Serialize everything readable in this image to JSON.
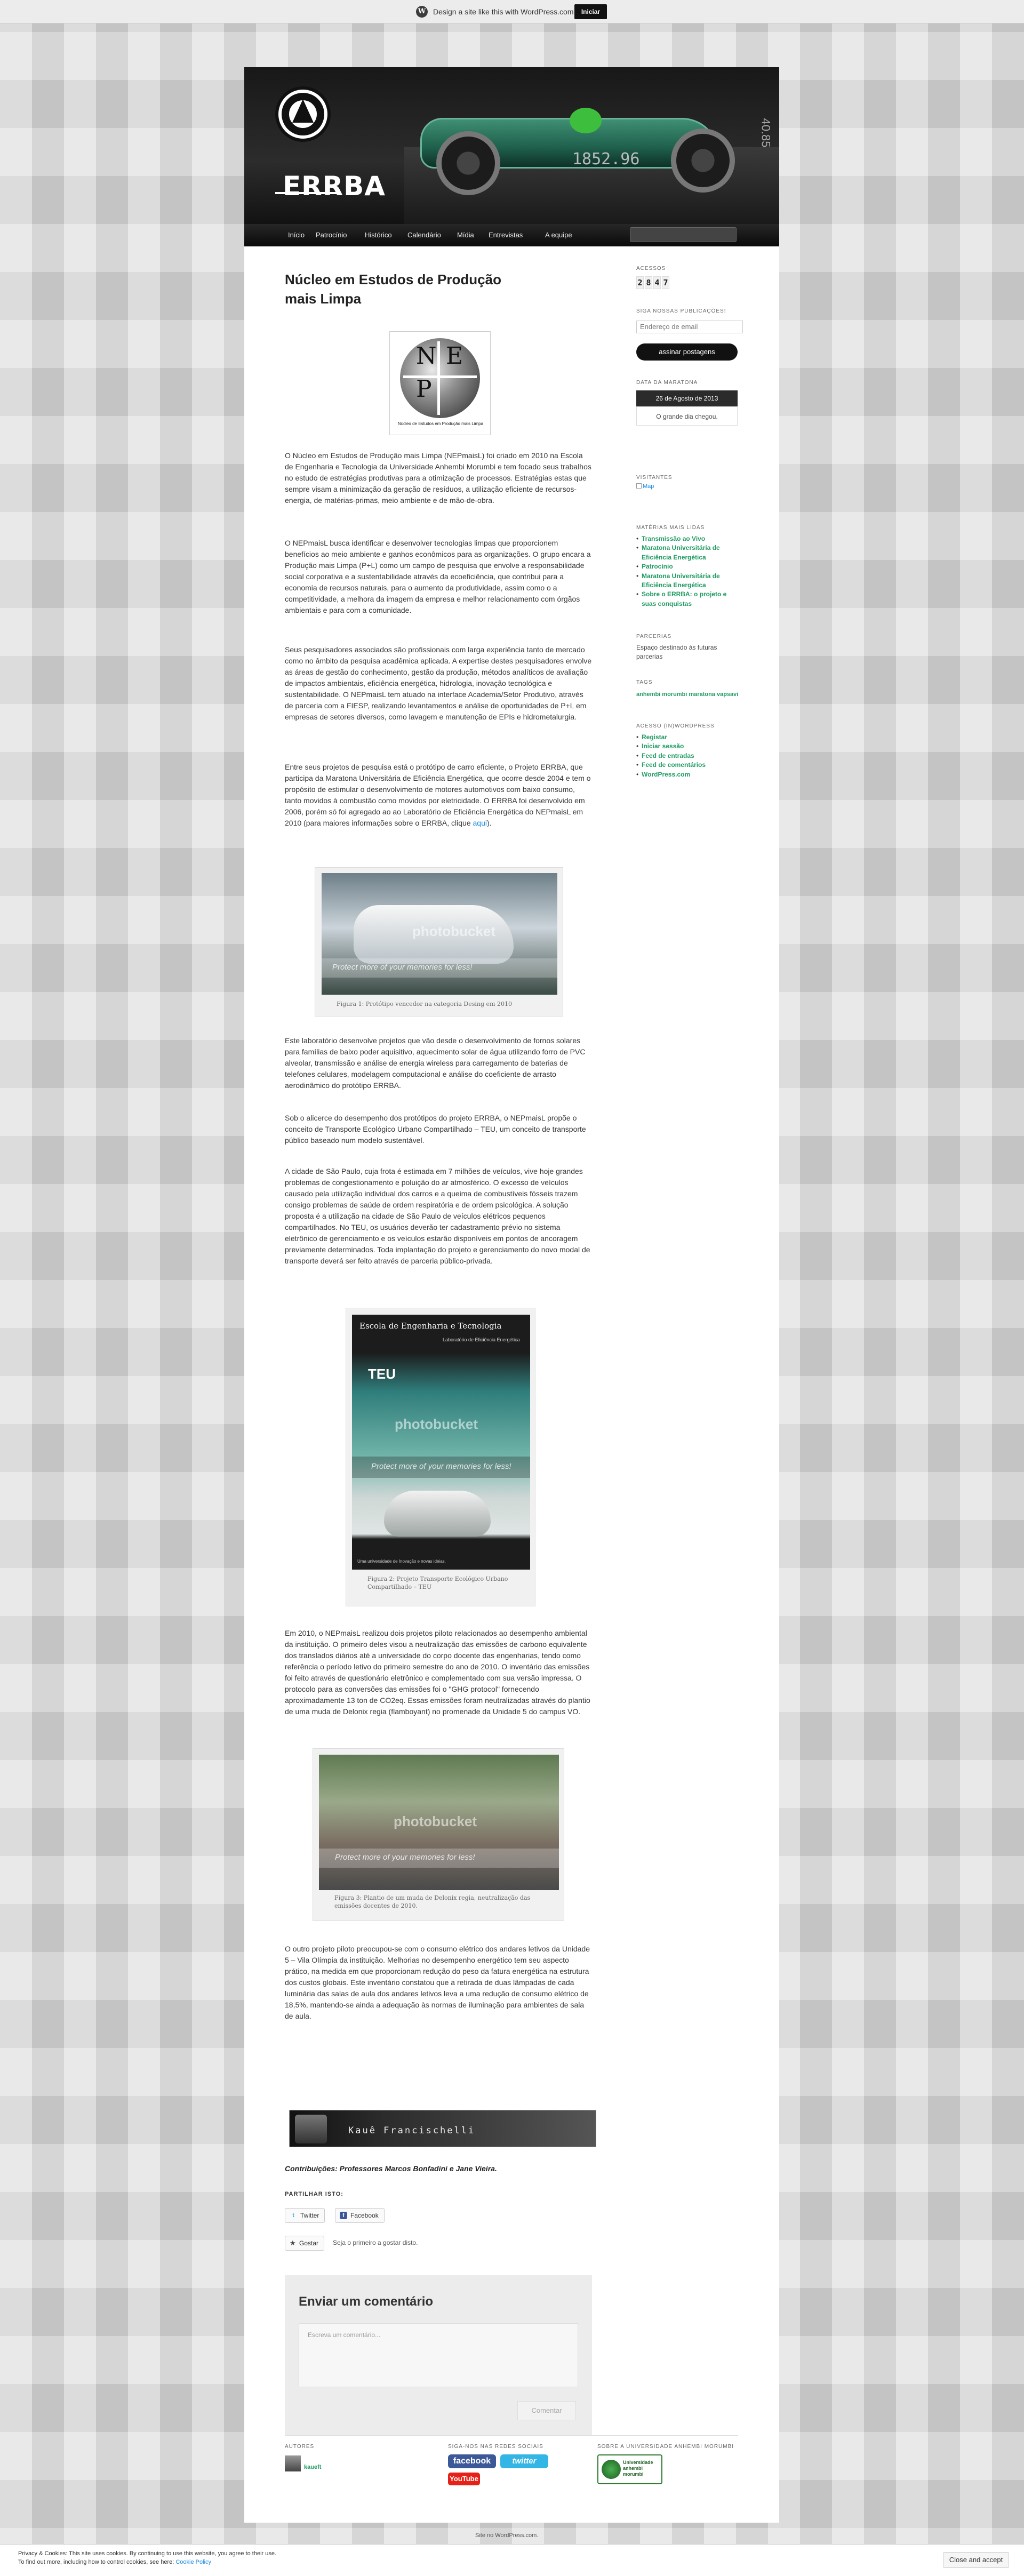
{
  "promo": {
    "text": "Design a site like this with WordPress.com",
    "button": "Iniciar"
  },
  "header": {
    "logo_text": "ERRBA",
    "banner_number": "1852.96",
    "banner_side_text": "40.85"
  },
  "nav": {
    "items": [
      "Início",
      "Patrocínio",
      "Histórico",
      "Calendário",
      "Mídia",
      "Entrevistas",
      "A equipe"
    ]
  },
  "post": {
    "title": "Núcleo em Estudos de Produção mais Limpa",
    "logo_caption": "Núcleo de Estudos em Produção mais Limpa",
    "paragraphs": [
      "O Núcleo em Estudos de Produção mais Limpa (NEPmaisL) foi criado em 2010 na Escola de Engenharia e Tecnologia da Universidade Anhembi Morumbi e tem focado seus trabalhos no estudo de estratégias produtivas para a otimização de processos. Estratégias estas que sempre visam a minimização da geração de resíduos, a utilização eficiente de recursos-energia, de matérias-primas, meio ambiente e de mão-de-obra.",
      "O NEPmaisL busca identificar e desenvolver tecnologias limpas que proporcionem benefícios ao meio ambiente e ganhos econômicos para as organizações. O grupo encara a Produção mais Limpa (P+L) como um campo de pesquisa que envolve a responsabilidade social corporativa e a sustentabilidade através da ecoeficiência, que contribui para a economia de recursos naturais, para o aumento da produtividade, assim como o a competitividade, a melhora da imagem da empresa e melhor relacionamento com órgãos ambientais e para com a comunidade.",
      "Seus pesquisadores associados são profissionais com larga experiência tanto de mercado como no âmbito da pesquisa acadêmica aplicada. A expertise destes pesquisadores envolve as áreas de gestão do conhecimento, gestão da produção, métodos analíticos de avaliação de impactos ambientais, eficiência energética, hidrologia, inovação tecnológica e sustentabilidade. O NEPmaisL tem atuado na interface Academia/Setor Produtivo, através de parceria com a FIESP, realizando levantamentos e análise de oportunidades de P+L em empresas de setores diversos, como lavagem e manutenção de EPIs e hidrometalurgia.",
      "Entre seus projetos de pesquisa está o protótipo de carro eficiente, o Projeto ERRBA, que participa da Maratona Universitária de Eficiência Energética, que ocorre desde 2004 e tem o propósito de estimular o desenvolvimento de motores automotivos com baixo consumo, tanto movidos à combustão como movidos por eletricidade. O ERRBA foi desenvolvido em 2006, porém só foi agregado ao ao Laboratório de Eficiência Energética do NEPmaisL em 2010 (para maiores informações sobre o ERRBA, clique",
      "Este laboratório desenvolve projetos que vão desde o desenvolvimento de fornos solares para famílias de baixo poder aquisitivo, aquecimento solar de água utilizando forro de PVC alveolar, transmissão e análise de energia wireless para carregamento de baterias de telefones celulares, modelagem computacional e análise do coeficiente de arrasto aerodinâmico do protótipo ERRBA.",
      "Sob o alicerce do desempenho dos protótipos do projeto ERRBA, o NEPmaisL propõe o conceito de Transporte Ecológico Urbano Compartilhado – TEU, um conceito de transporte público baseado num modelo sustentável.",
      "A cidade de São Paulo, cuja frota é estimada em 7 milhões de veículos, vive hoje grandes problemas de congestionamento e poluição do ar atmosférico. O excesso de veículos causado pela utilização individual dos carros e a queima de combustíveis fósseis trazem consigo problemas de saúde de ordem respiratória e de ordem psicológica. A solução proposta é a utilização na cidade de São Paulo de veículos elétricos pequenos compartilhados. No TEU, os usuários deverão ter cadastramento prévio no sistema eletrônico de gerenciamento e os veículos estarão disponíveis em pontos de ancoragem previamente determinados. Toda implantação do projeto e gerenciamento do novo modal de transporte deverá ser feito através de parceria público-privada.",
      "Em 2010, o NEPmaisL realizou dois projetos piloto relacionados ao desempenho ambiental da instituição. O primeiro deles visou a neutralização das emissões de carbono equivalente dos translados diários até a universidade do corpo docente das engenharias, tendo como referência o período letivo do primeiro semestre do ano de 2010. O inventário das emissões foi feito através de questionário eletrônico e complementado com sua versão impressa. O protocolo para as conversões das emissões foi o \"GHG protocol\" fornecendo aproximadamente 13 ton de CO2eq. Essas emissões foram neutralizadas através do plantio de uma muda de Delonix regia (flamboyant) no promenade da Unidade 5 do campus VO.",
      "O outro projeto piloto preocupou-se com o consumo elétrico dos andares letivos da Unidade 5 – Vila Olímpia da instituição. Melhorias no desempenho energético tem seu aspecto prático, na medida em que proporcionam redução do peso da fatura energética na estrutura dos custos globais. Este inventário constatou que a retirada de duas lâmpadas de cada luminária das salas de aula dos andares letivos leva a uma redução de consumo elétrico de 18,5%, mantendo-se ainda a adequação às normas de iluminação para ambientes de sala de aula."
    ],
    "link_aqui": "aqui",
    "link_close": ").",
    "figures": [
      {
        "caption": "Figura 1: Protótipo vencedor na categoria Desing em 2010",
        "watermark": "photobucket",
        "banner": "Protect more of your memories for less!"
      },
      {
        "caption": "Figura 2: Projeto Transporte Ecológico Urbano Compartilhado – TEU",
        "watermark": "photobucket",
        "banner": "Protect more of your memories for less!",
        "poster_title": "Escola de Engenharia e Tecnologia",
        "poster_sub": "Laboratório de Eficiência Energética",
        "poster_teu": "TEU",
        "poster_footer": "Uma universidade de Inovação e novas ideias."
      },
      {
        "caption": "Figura 3: Plantio de um muda de Delonix regia, neutralização das emissões docentes de 2010.",
        "watermark": "photobucket",
        "banner": "Protect more of your memories for less!"
      }
    ],
    "signature_name": "Kauê Francischelli",
    "contrib": "Contribuições: Professores Marcos Bonfadini e Jane Vieira.",
    "share_label": "PARTILHAR ISTO:",
    "share_twitter": "Twitter",
    "share_facebook": "Facebook",
    "like_label": "Gostar",
    "like_text": "Seja o primeiro a gostar disto."
  },
  "comment": {
    "title": "Enviar um comentário",
    "placeholder": "Escreva um comentário...",
    "submit": "Comentar"
  },
  "sidebar": {
    "acessos_title": "ACESSOS",
    "acessos_digits": [
      "2",
      "8",
      "4",
      "7"
    ],
    "follow_title": "SIGA NOSSAS PUBLICAÇÕES!",
    "email_placeholder": "Endereço de email",
    "follow_button": "assinar postagens",
    "maratona_title": "DATA DA MARATONA",
    "maratona_date": "26 de Agosto de 2013",
    "maratona_text": "O grande dia chegou.",
    "visitantes_title": "VISITANTES",
    "visitantes_img": "Map",
    "materias_title": "MATÉRIAS MAIS LIDAS",
    "materias": [
      "Transmissão ao Vivo",
      "Maratona Universitária de Eficiência Energética",
      "Patrocínio",
      "Maratona Universitária de Eficiência Energética",
      "Sobre o ERRBA: o projeto e suas conquistas"
    ],
    "parcerias_title": "PARCERIAS",
    "parcerias_text": "Espaço destinado às futuras parcerias",
    "tags_title": "TAGS",
    "tags_text": "anhembi morumbi maratona vapsavi",
    "acesso_title": "ACESSO (IN)WORDPRESS",
    "acesso_links": [
      "Registar",
      "Iniciar sessão",
      "Feed de entradas",
      "Feed de comentários",
      "WordPress.com"
    ]
  },
  "footer": {
    "autores_title": "AUTORES",
    "author_name": "kaueft",
    "redes_title": "SIGA-NOS NAS REDES SOCIAIS",
    "facebook": "facebook",
    "twitter": "twitter",
    "youtube": "YouTube",
    "sobre_title": "SOBRE A UNIVERSIDADE ANHEMBI MORUMBI",
    "uam_text": "Universidade anhembi morumbi",
    "site_text": "Site no WordPress.com."
  },
  "cookie": {
    "text": "Privacy & Cookies: This site uses cookies. By continuing to use this website, you agree to their use.",
    "text2": "To find out more, including how to control cookies, see here:",
    "link": "Cookie Policy",
    "button": "Close and accept"
  }
}
